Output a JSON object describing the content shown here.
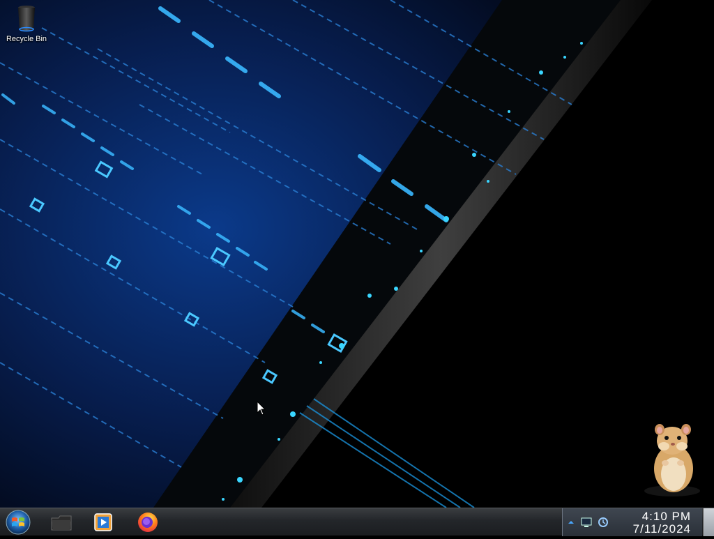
{
  "desktop": {
    "wallpaper": "dark-blue-tech-circuit",
    "icons": [
      {
        "label": "Recycle Bin",
        "icon": "recycle-bin-icon"
      }
    ],
    "widget": "hamster-gadget"
  },
  "taskbar": {
    "start_icon": "windows-start-orb-icon",
    "pinned": [
      {
        "name": "file-explorer",
        "icon": "folder-icon"
      },
      {
        "name": "media-player",
        "icon": "media-player-icon"
      },
      {
        "name": "firefox",
        "icon": "firefox-icon"
      }
    ],
    "tray": {
      "icons": [
        "show-hidden-icons-arrow",
        "network-monitor-icon",
        "network-activity-icon"
      ],
      "time": "4:10 PM",
      "date": "7/11/2024"
    }
  },
  "colors": {
    "accent": "#1ea8ff",
    "glow": "#3ad6ff",
    "taskbar": "#23262a"
  }
}
